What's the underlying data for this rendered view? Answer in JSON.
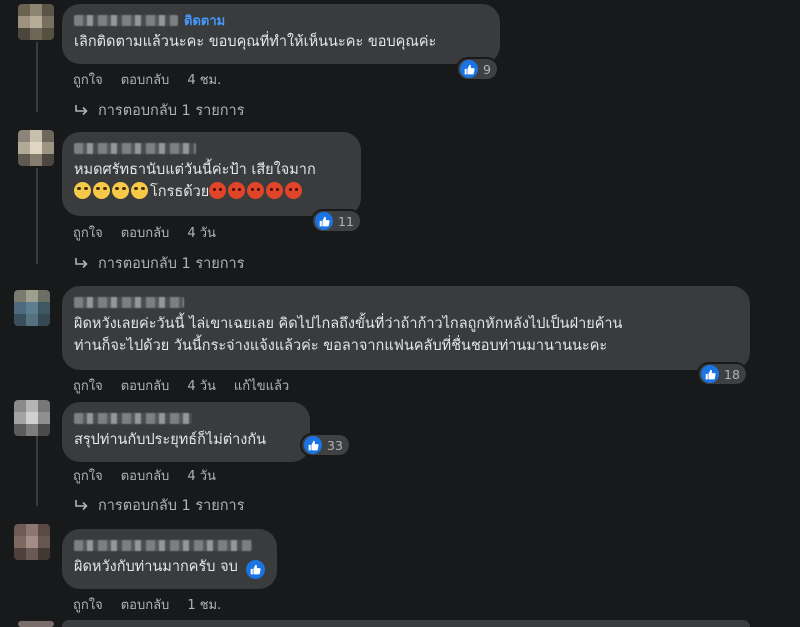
{
  "comments": [
    {
      "follow_label": "ติดตาม",
      "text_lines": [
        "เลิกติดตามแล้วนะคะ ขอบคุณที่ทำให้เห็นนะคะ ขอบคุณค่ะ"
      ],
      "reaction_count": "9",
      "like": "ถูกใจ",
      "reply": "ตอบกลับ",
      "time": "4 ชม.",
      "replies_label": "การตอบกลับ 1 รายการ"
    },
    {
      "text_lines": [
        "หมดศรัทธานับแต่วันนี้ค่ะป้า เสียใจมาก",
        "โกรธด้วย"
      ],
      "reaction_count": "11",
      "like": "ถูกใจ",
      "reply": "ตอบกลับ",
      "time": "4 วัน",
      "replies_label": "การตอบกลับ 1 รายการ"
    },
    {
      "text_lines": [
        "ผิดหวังเลยค่ะวันนี้ ไล่เขาเฉยเลย คิดไปไกลถึงขั้นที่ว่าถ้าก้าวไกลถูกหักหลังไปเป็นฝ่ายค้าน",
        "ท่านก็จะไปด้วย วันนี้กระจ่างแจ้งแล้วค่ะ ขอลาจากแฟนคลับที่ชื่นชอบท่านมานานนะคะ"
      ],
      "reaction_count": "18",
      "like": "ถูกใจ",
      "reply": "ตอบกลับ",
      "time": "4 วัน",
      "edited": "แก้ไขแล้ว"
    },
    {
      "text_lines": [
        "สรุปท่านกับประยุทธ์ก็ไม่ต่างกัน"
      ],
      "reaction_count": "33",
      "like": "ถูกใจ",
      "reply": "ตอบกลับ",
      "time": "4 วัน",
      "replies_label": "การตอบกลับ 1 รายการ"
    },
    {
      "text_lines": [
        "ผิดหวังกับท่านมากครับ จบ"
      ],
      "like": "ถูกใจ",
      "reply": "ตอบกลับ",
      "time": "1 ชม."
    }
  ],
  "icons": {
    "reaction": "like-icon",
    "replies": "reply-arrow-icon",
    "emoji_cry": "crying-face-emoji",
    "emoji_angry": "angry-face-emoji"
  },
  "colors": {
    "background": "#18191a",
    "bubble": "#3a3b3c",
    "like_blue": "#1b74e4",
    "follow_link": "#4599ff",
    "meta_text": "#b0b3b8"
  }
}
